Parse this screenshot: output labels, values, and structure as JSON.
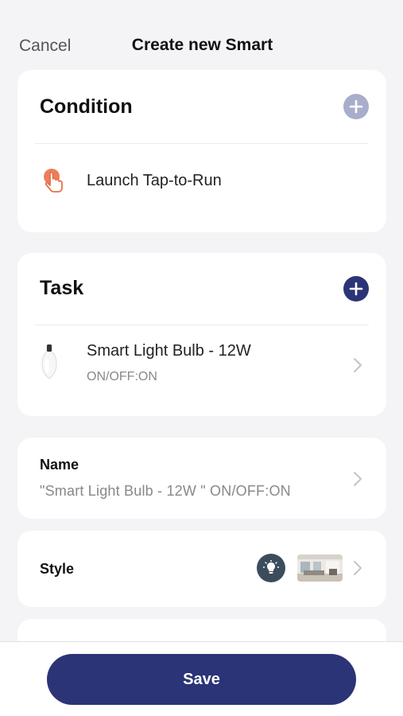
{
  "header": {
    "cancel_label": "Cancel",
    "title": "Create new Smart"
  },
  "condition": {
    "title": "Condition",
    "add_icon": "plus-icon",
    "add_color": "#a9adcc",
    "item": {
      "icon": "tap-icon",
      "label": "Launch Tap-to-Run"
    }
  },
  "task": {
    "title": "Task",
    "add_icon": "plus-icon",
    "add_color": "#2b3476",
    "item": {
      "icon": "bulb-icon",
      "title": "Smart Light Bulb - 12W",
      "subtitle": "ON/OFF:ON"
    }
  },
  "name": {
    "label": "Name",
    "value": "\"Smart Light Bulb - 12W \" ON/OFF:ON"
  },
  "style": {
    "label": "Style",
    "icon": "bulb-icon",
    "thumbnail": "room-thumbnail"
  },
  "footer": {
    "save_label": "Save"
  },
  "colors": {
    "accent": "#2b3476",
    "tap_icon": "#e8704a",
    "background": "#f4f4f6"
  }
}
